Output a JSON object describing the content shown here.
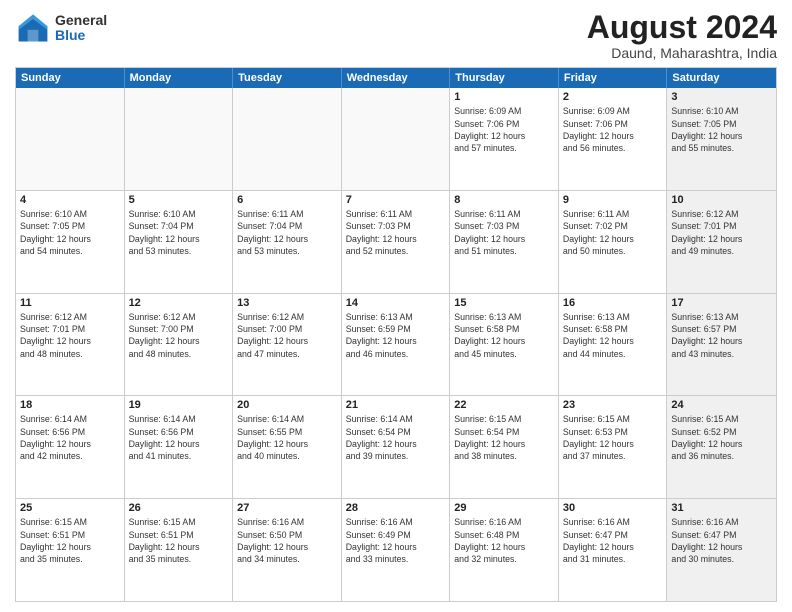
{
  "logo": {
    "general": "General",
    "blue": "Blue"
  },
  "title": {
    "month": "August 2024",
    "location": "Daund, Maharashtra, India"
  },
  "header_days": [
    "Sunday",
    "Monday",
    "Tuesday",
    "Wednesday",
    "Thursday",
    "Friday",
    "Saturday"
  ],
  "weeks": [
    [
      {
        "day": "",
        "info": "",
        "empty": true
      },
      {
        "day": "",
        "info": "",
        "empty": true
      },
      {
        "day": "",
        "info": "",
        "empty": true
      },
      {
        "day": "",
        "info": "",
        "empty": true
      },
      {
        "day": "1",
        "info": "Sunrise: 6:09 AM\nSunset: 7:06 PM\nDaylight: 12 hours\nand 57 minutes."
      },
      {
        "day": "2",
        "info": "Sunrise: 6:09 AM\nSunset: 7:06 PM\nDaylight: 12 hours\nand 56 minutes."
      },
      {
        "day": "3",
        "info": "Sunrise: 6:10 AM\nSunset: 7:05 PM\nDaylight: 12 hours\nand 55 minutes.",
        "shaded": true
      }
    ],
    [
      {
        "day": "4",
        "info": "Sunrise: 6:10 AM\nSunset: 7:05 PM\nDaylight: 12 hours\nand 54 minutes."
      },
      {
        "day": "5",
        "info": "Sunrise: 6:10 AM\nSunset: 7:04 PM\nDaylight: 12 hours\nand 53 minutes."
      },
      {
        "day": "6",
        "info": "Sunrise: 6:11 AM\nSunset: 7:04 PM\nDaylight: 12 hours\nand 53 minutes."
      },
      {
        "day": "7",
        "info": "Sunrise: 6:11 AM\nSunset: 7:03 PM\nDaylight: 12 hours\nand 52 minutes."
      },
      {
        "day": "8",
        "info": "Sunrise: 6:11 AM\nSunset: 7:03 PM\nDaylight: 12 hours\nand 51 minutes."
      },
      {
        "day": "9",
        "info": "Sunrise: 6:11 AM\nSunset: 7:02 PM\nDaylight: 12 hours\nand 50 minutes."
      },
      {
        "day": "10",
        "info": "Sunrise: 6:12 AM\nSunset: 7:01 PM\nDaylight: 12 hours\nand 49 minutes.",
        "shaded": true
      }
    ],
    [
      {
        "day": "11",
        "info": "Sunrise: 6:12 AM\nSunset: 7:01 PM\nDaylight: 12 hours\nand 48 minutes."
      },
      {
        "day": "12",
        "info": "Sunrise: 6:12 AM\nSunset: 7:00 PM\nDaylight: 12 hours\nand 48 minutes."
      },
      {
        "day": "13",
        "info": "Sunrise: 6:12 AM\nSunset: 7:00 PM\nDaylight: 12 hours\nand 47 minutes."
      },
      {
        "day": "14",
        "info": "Sunrise: 6:13 AM\nSunset: 6:59 PM\nDaylight: 12 hours\nand 46 minutes."
      },
      {
        "day": "15",
        "info": "Sunrise: 6:13 AM\nSunset: 6:58 PM\nDaylight: 12 hours\nand 45 minutes."
      },
      {
        "day": "16",
        "info": "Sunrise: 6:13 AM\nSunset: 6:58 PM\nDaylight: 12 hours\nand 44 minutes."
      },
      {
        "day": "17",
        "info": "Sunrise: 6:13 AM\nSunset: 6:57 PM\nDaylight: 12 hours\nand 43 minutes.",
        "shaded": true
      }
    ],
    [
      {
        "day": "18",
        "info": "Sunrise: 6:14 AM\nSunset: 6:56 PM\nDaylight: 12 hours\nand 42 minutes."
      },
      {
        "day": "19",
        "info": "Sunrise: 6:14 AM\nSunset: 6:56 PM\nDaylight: 12 hours\nand 41 minutes."
      },
      {
        "day": "20",
        "info": "Sunrise: 6:14 AM\nSunset: 6:55 PM\nDaylight: 12 hours\nand 40 minutes."
      },
      {
        "day": "21",
        "info": "Sunrise: 6:14 AM\nSunset: 6:54 PM\nDaylight: 12 hours\nand 39 minutes."
      },
      {
        "day": "22",
        "info": "Sunrise: 6:15 AM\nSunset: 6:54 PM\nDaylight: 12 hours\nand 38 minutes."
      },
      {
        "day": "23",
        "info": "Sunrise: 6:15 AM\nSunset: 6:53 PM\nDaylight: 12 hours\nand 37 minutes."
      },
      {
        "day": "24",
        "info": "Sunrise: 6:15 AM\nSunset: 6:52 PM\nDaylight: 12 hours\nand 36 minutes.",
        "shaded": true
      }
    ],
    [
      {
        "day": "25",
        "info": "Sunrise: 6:15 AM\nSunset: 6:51 PM\nDaylight: 12 hours\nand 35 minutes."
      },
      {
        "day": "26",
        "info": "Sunrise: 6:15 AM\nSunset: 6:51 PM\nDaylight: 12 hours\nand 35 minutes."
      },
      {
        "day": "27",
        "info": "Sunrise: 6:16 AM\nSunset: 6:50 PM\nDaylight: 12 hours\nand 34 minutes."
      },
      {
        "day": "28",
        "info": "Sunrise: 6:16 AM\nSunset: 6:49 PM\nDaylight: 12 hours\nand 33 minutes."
      },
      {
        "day": "29",
        "info": "Sunrise: 6:16 AM\nSunset: 6:48 PM\nDaylight: 12 hours\nand 32 minutes."
      },
      {
        "day": "30",
        "info": "Sunrise: 6:16 AM\nSunset: 6:47 PM\nDaylight: 12 hours\nand 31 minutes."
      },
      {
        "day": "31",
        "info": "Sunrise: 6:16 AM\nSunset: 6:47 PM\nDaylight: 12 hours\nand 30 minutes.",
        "shaded": true
      }
    ]
  ]
}
